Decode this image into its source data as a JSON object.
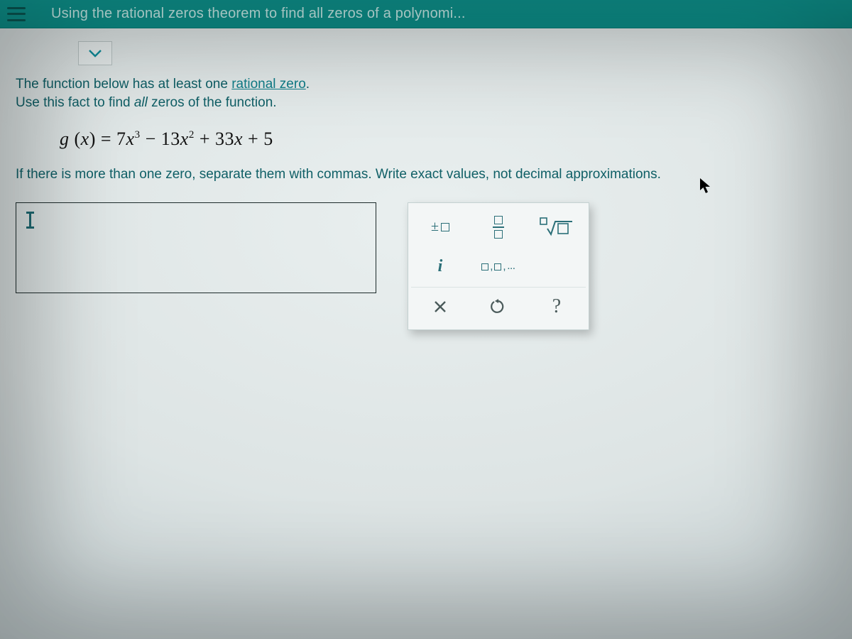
{
  "header": {
    "title": "Using the rational zeros theorem to find all zeros of a polynomi..."
  },
  "problem": {
    "line1_pre": "The function below has at least one ",
    "line1_link": "rational zero",
    "line1_post": ".",
    "line2_pre": "Use this fact to find ",
    "line2_em": "all",
    "line2_post": " zeros of the function.",
    "instruction": "If there is more than one zero, separate them with commas. Write exact values, not decimal approximations."
  },
  "equation": {
    "fn": "g",
    "arg": "x",
    "rhs_terms": [
      "7x",
      "13x",
      "33x",
      "5"
    ],
    "rhs_exponents": [
      "3",
      "2",
      "",
      ""
    ],
    "rhs_signs": [
      "",
      "−",
      "+",
      "+"
    ],
    "display": "g (x) = 7x³ − 13x² + 33x + 5"
  },
  "answer": {
    "value": ""
  },
  "palette": {
    "plusminus": "±",
    "fraction": "fraction",
    "nthroot": "nth-root",
    "imaginary": "i",
    "list": "□,□,...",
    "clear": "×",
    "reset": "↺",
    "help": "?"
  }
}
